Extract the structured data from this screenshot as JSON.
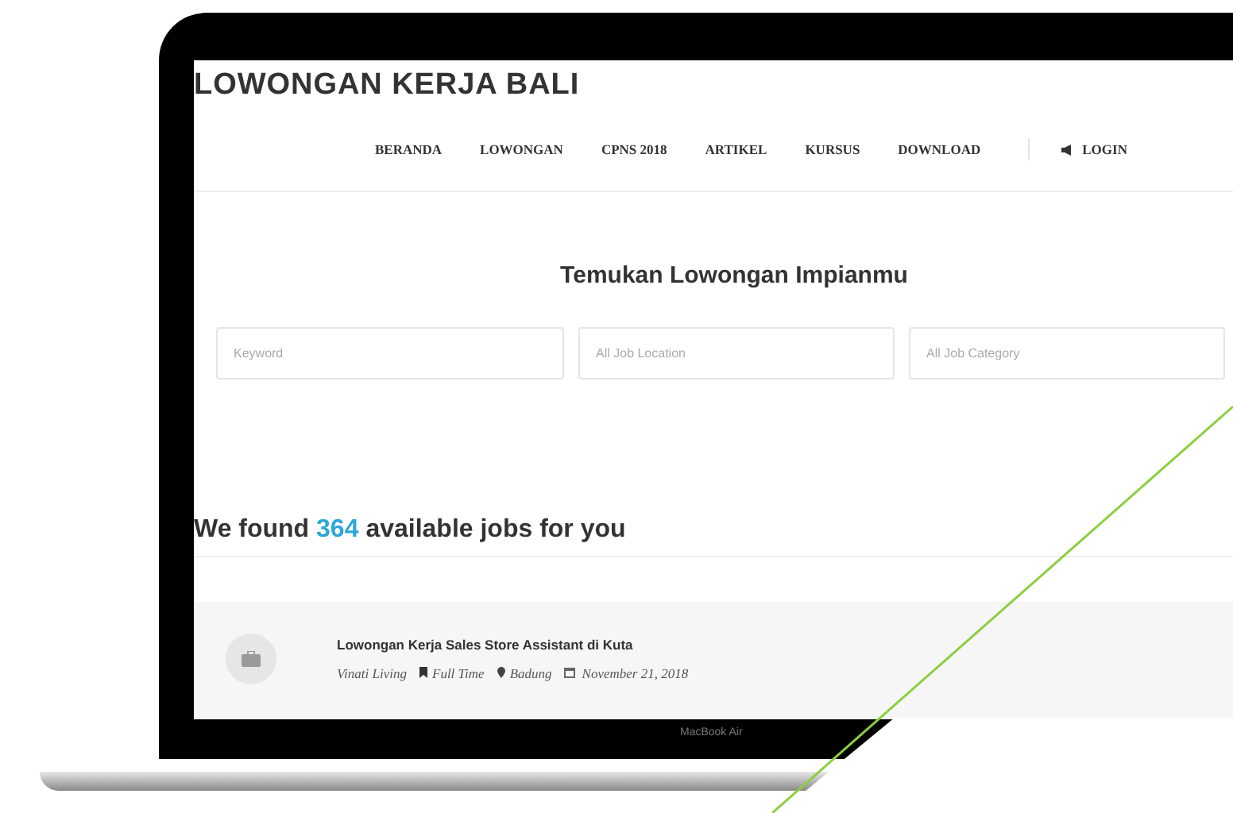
{
  "site_title": "LOWONGAN KERJA BALI",
  "nav": [
    {
      "label": "BERANDA"
    },
    {
      "label": "LOWONGAN"
    },
    {
      "label": "CPNS 2018"
    },
    {
      "label": "ARTIKEL"
    },
    {
      "label": "KURSUS"
    },
    {
      "label": "DOWNLOAD"
    }
  ],
  "login": {
    "label": "LOGIN"
  },
  "search": {
    "heading": "Temukan Lowongan Impianmu",
    "fields": [
      {
        "placeholder": "Keyword"
      },
      {
        "placeholder": "All Job Location"
      },
      {
        "placeholder": "All Job Category"
      }
    ]
  },
  "results": {
    "prefix": "We found",
    "count": "364",
    "suffix": "available jobs for you"
  },
  "jobs": [
    {
      "title": "Lowongan Kerja Sales Store Assistant di Kuta",
      "company": "Vinati Living",
      "type": "Full Time",
      "location": "Badung",
      "date": "November 21, 2018"
    }
  ],
  "device_label": "MacBook Air"
}
